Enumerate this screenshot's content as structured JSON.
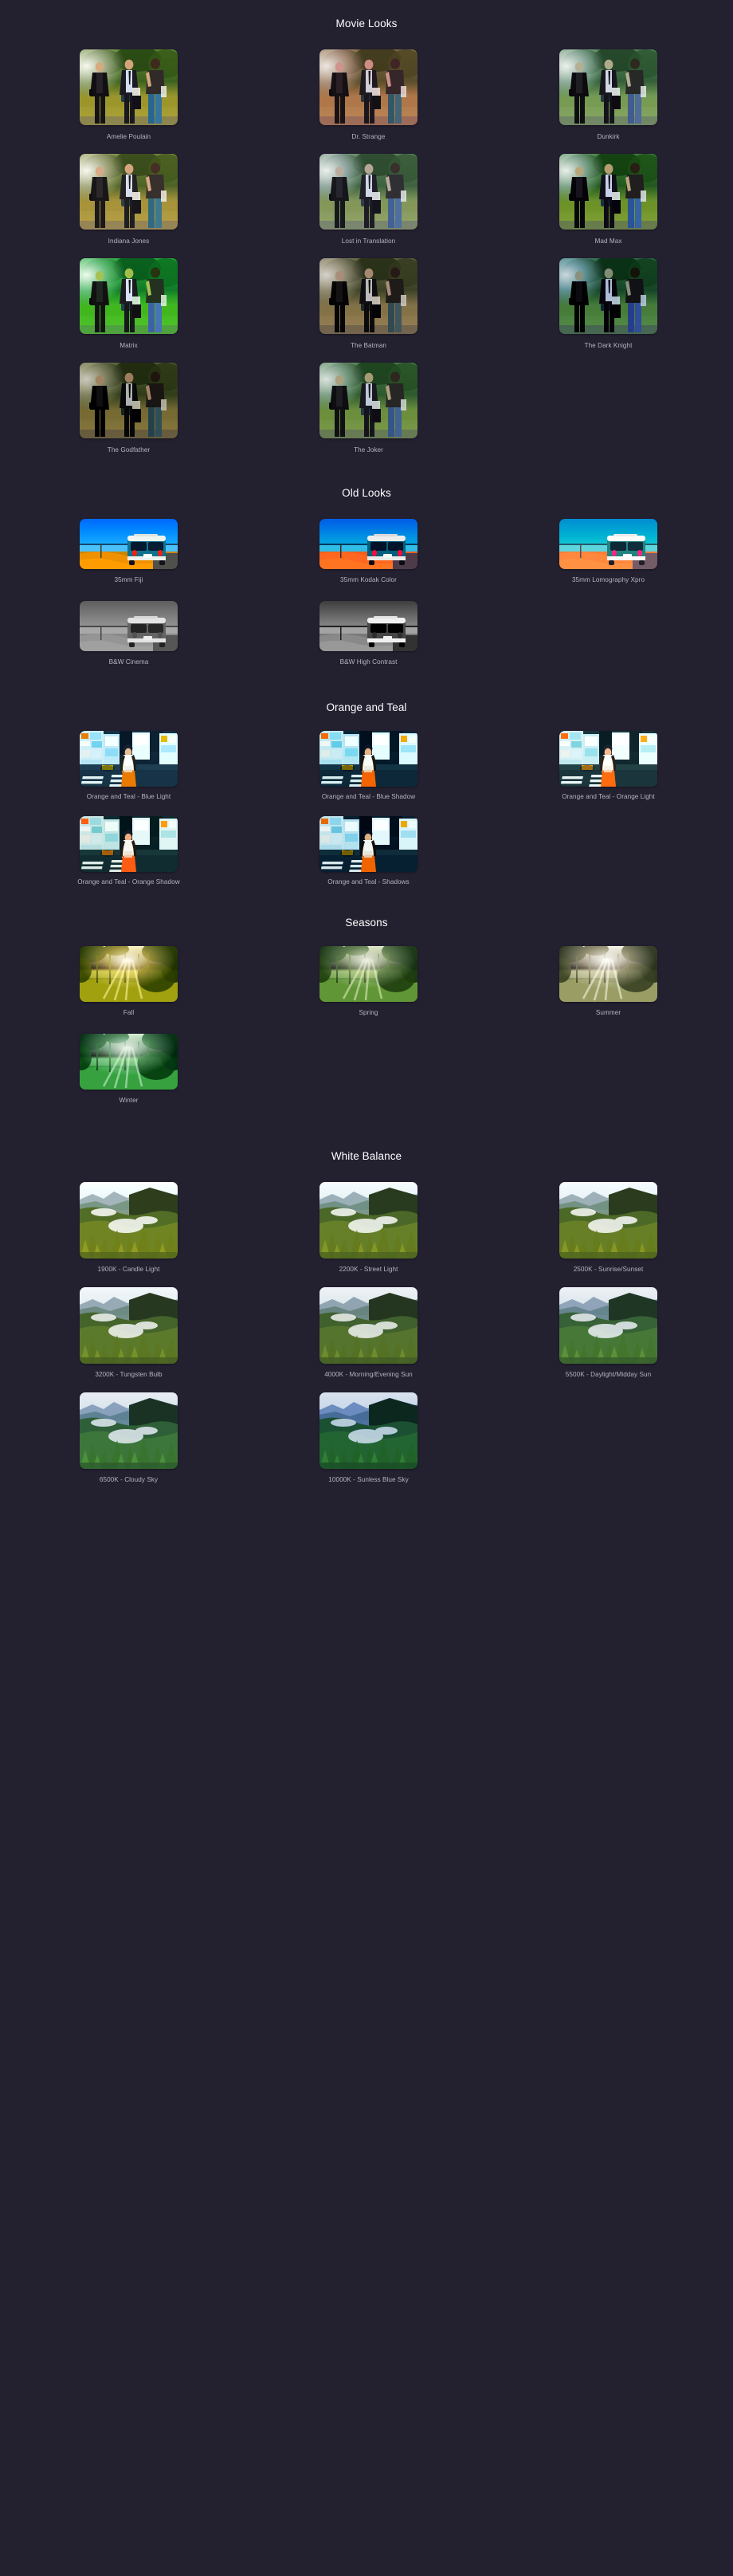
{
  "page": {
    "background_color": "#232030",
    "title_color": "#ffffff",
    "caption_color": "#b5b2c2"
  },
  "sections": [
    {
      "id": "movie",
      "title": "Movie Looks",
      "thumb_subject": "three-men-walking-field",
      "items": [
        {
          "label": "Amelie Poulain",
          "tint": "rgba(255,235,150,0.10)",
          "sat": 1.15,
          "bright": 1.0,
          "hue": 0,
          "contrast": 1.05
        },
        {
          "label": "Dr. Strange",
          "tint": "rgba(215,110,120,0.34)",
          "sat": 0.78,
          "bright": 0.95,
          "hue": -18,
          "contrast": 1.02
        },
        {
          "label": "Dunkirk",
          "tint": "rgba(150,220,220,0.22)",
          "sat": 0.72,
          "bright": 0.95,
          "hue": 20,
          "contrast": 1.08
        },
        {
          "label": "Indiana Jones",
          "tint": "rgba(215,175,110,0.22)",
          "sat": 1.0,
          "bright": 1.02,
          "hue": -6,
          "contrast": 1.0
        },
        {
          "label": "Lost in Translation",
          "tint": "rgba(150,180,225,0.26)",
          "sat": 0.75,
          "bright": 0.98,
          "hue": 12,
          "contrast": 1.0
        },
        {
          "label": "Mad Max",
          "tint": "rgba(120,190,215,0.20)",
          "sat": 1.1,
          "bright": 0.92,
          "hue": 14,
          "contrast": 1.14
        },
        {
          "label": "Matrix",
          "tint": "rgba(60,220,80,0.34)",
          "sat": 1.4,
          "bright": 1.0,
          "hue": 35,
          "contrast": 1.05
        },
        {
          "label": "The Batman",
          "tint": "rgba(190,150,110,0.28)",
          "sat": 0.5,
          "bright": 0.82,
          "hue": -8,
          "contrast": 1.12
        },
        {
          "label": "The Dark Knight",
          "tint": "rgba(60,150,230,0.32)",
          "sat": 0.85,
          "bright": 0.82,
          "hue": 25,
          "contrast": 1.2
        },
        {
          "label": "The Godfather",
          "tint": "rgba(180,150,60,0.20)",
          "sat": 0.65,
          "bright": 0.78,
          "hue": -5,
          "contrast": 1.15
        },
        {
          "label": "The Joker",
          "tint": "rgba(120,200,190,0.18)",
          "sat": 0.9,
          "bright": 0.9,
          "hue": 16,
          "contrast": 1.05
        }
      ]
    },
    {
      "id": "old",
      "title": "Old Looks",
      "thumb_subject": "vw-bus-by-lake",
      "items": [
        {
          "label": "35mm Fiji",
          "tint": "rgba(40,120,230,0.14)",
          "sat": 1.45,
          "bright": 1.02,
          "hue": 0,
          "contrast": 1.1,
          "gray": 0
        },
        {
          "label": "35mm Kodak Color",
          "tint": "rgba(90,50,200,0.30)",
          "sat": 1.6,
          "bright": 0.98,
          "hue": -14,
          "contrast": 1.15,
          "gray": 0
        },
        {
          "label": "35mm Lomography Xpro",
          "tint": "rgba(190,140,230,0.30)",
          "sat": 1.3,
          "bright": 1.1,
          "hue": -26,
          "contrast": 1.0,
          "gray": 0
        },
        {
          "label": "B&W Cinema",
          "tint": "rgba(255,255,255,0.0)",
          "sat": 0,
          "bright": 1.02,
          "hue": 0,
          "contrast": 0.95,
          "gray": 1
        },
        {
          "label": "B&W High Contrast",
          "tint": "rgba(0,0,0,0.06)",
          "sat": 0,
          "bright": 0.95,
          "hue": 0,
          "contrast": 1.5,
          "gray": 1
        }
      ]
    },
    {
      "id": "ot",
      "title": "Orange and Teal",
      "thumb_subject": "woman-crossing-street-city",
      "items": [
        {
          "label": "Orange and Teal - Blue Light",
          "tint": "rgba(110,215,225,0.18)",
          "sat": 1.25,
          "bright": 1.05,
          "hue": 8,
          "contrast": 1.05
        },
        {
          "label": "Orange and Teal - Blue Shadow",
          "tint": "rgba(60,180,200,0.14)",
          "sat": 1.3,
          "bright": 1.0,
          "hue": 4,
          "contrast": 1.12
        },
        {
          "label": "Orange and Teal - Orange Light",
          "tint": "rgba(250,190,120,0.12)",
          "sat": 1.2,
          "bright": 1.08,
          "hue": -4,
          "contrast": 1.02
        },
        {
          "label": "Orange and Teal - Orange Shadow",
          "tint": "rgba(245,160,80,0.16)",
          "sat": 1.25,
          "bright": 1.0,
          "hue": -8,
          "contrast": 1.08
        },
        {
          "label": "Orange and Teal - Shadows",
          "tint": "rgba(90,190,205,0.12)",
          "sat": 1.18,
          "bright": 0.96,
          "hue": 6,
          "contrast": 1.18
        }
      ]
    },
    {
      "id": "season",
      "title": "Seasons",
      "thumb_subject": "sunbeams-through-forest",
      "items": [
        {
          "label": "Fall",
          "tint": "rgba(235,200,40,0.30)",
          "sat": 1.5,
          "bright": 1.02,
          "hue": -14,
          "contrast": 1.05
        },
        {
          "label": "Spring",
          "tint": "rgba(110,200,110,0.16)",
          "sat": 1.1,
          "bright": 0.98,
          "hue": 6,
          "contrast": 1.0
        },
        {
          "label": "Summer",
          "tint": "rgba(230,205,160,0.26)",
          "sat": 0.55,
          "bright": 1.05,
          "hue": -6,
          "contrast": 1.0
        },
        {
          "label": "Winter",
          "tint": "rgba(90,220,190,0.22)",
          "sat": 1.2,
          "bright": 0.94,
          "hue": 30,
          "contrast": 1.12
        }
      ]
    },
    {
      "id": "wb",
      "title": "White Balance",
      "thumb_subject": "misty-mountain-pines",
      "items": [
        {
          "label": "1900K - Candle Light",
          "tint": "rgba(255,215,145,0.20)",
          "sat": 1.15,
          "bright": 1.06,
          "hue": -10,
          "contrast": 1.0
        },
        {
          "label": "2200K - Street Light",
          "tint": "rgba(255,225,170,0.14)",
          "sat": 1.1,
          "bright": 1.04,
          "hue": -7,
          "contrast": 1.0
        },
        {
          "label": "2500K - Sunrise/Sunset",
          "tint": "rgba(255,220,155,0.16)",
          "sat": 1.12,
          "bright": 1.04,
          "hue": -8,
          "contrast": 1.0
        },
        {
          "label": "3200K - Tungsten Bulb",
          "tint": "rgba(250,230,180,0.10)",
          "sat": 1.05,
          "bright": 1.02,
          "hue": -4,
          "contrast": 1.0
        },
        {
          "label": "4000K - Morning/Evening Sun",
          "tint": "rgba(245,235,205,0.06)",
          "sat": 1.0,
          "bright": 1.0,
          "hue": -2,
          "contrast": 1.0
        },
        {
          "label": "5500K - Daylight/Midday Sun",
          "tint": "rgba(150,200,235,0.16)",
          "sat": 0.95,
          "bright": 0.98,
          "hue": 10,
          "contrast": 1.02
        },
        {
          "label": "6500K - Cloudy Sky",
          "tint": "rgba(120,185,240,0.24)",
          "sat": 0.95,
          "bright": 0.95,
          "hue": 16,
          "contrast": 1.05
        },
        {
          "label": "10000K - Sunless Blue Sky",
          "tint": "rgba(50,120,230,0.34)",
          "sat": 1.05,
          "bright": 0.9,
          "hue": 22,
          "contrast": 1.1
        }
      ]
    }
  ]
}
